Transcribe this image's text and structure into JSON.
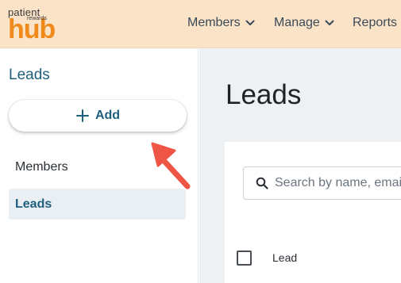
{
  "logo": {
    "line1": "patient",
    "line2": "rewards",
    "line3": "hub",
    "brand_color": "#f08a1d",
    "bar_color": "#fbe3c7"
  },
  "nav": {
    "members": "Members",
    "manage": "Manage",
    "reports": "Reports",
    "dropdown_icon": "chevron-down-icon"
  },
  "sidebar": {
    "title": "Leads",
    "add_label": "Add",
    "add_icon": "plus-icon",
    "items": [
      {
        "label": "Members",
        "active": false
      },
      {
        "label": "Leads",
        "active": true
      }
    ],
    "accent": "#1f5f7e"
  },
  "main": {
    "title": "Leads",
    "search": {
      "placeholder": "Search by name, email",
      "icon": "search-icon"
    },
    "table": {
      "columns": [
        "Lead"
      ]
    }
  },
  "annotation": {
    "arrow_color": "#ef5544",
    "icon": "red-arrow-icon"
  }
}
